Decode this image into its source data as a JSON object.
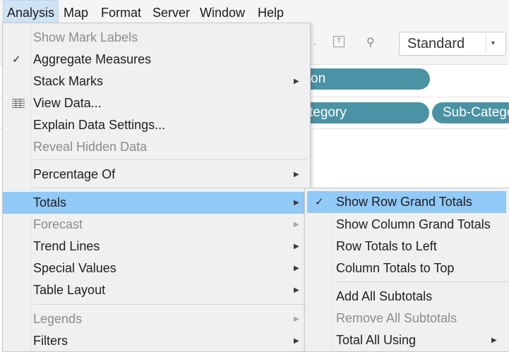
{
  "menubar": {
    "items": [
      {
        "label": "Analysis"
      },
      {
        "label": "Map"
      },
      {
        "label": "Format"
      },
      {
        "label": "Server"
      },
      {
        "label": "Window"
      },
      {
        "label": "Help"
      }
    ]
  },
  "toolbar": {
    "fit_select": {
      "value": "Standard"
    }
  },
  "shelves": {
    "columns_pill": "on",
    "rows_pill_1": "tegory",
    "rows_pill_2": "Sub-Catego"
  },
  "analysis_menu": {
    "items": [
      {
        "label": "Show Mark Labels",
        "enabled": false
      },
      {
        "label": "Aggregate Measures",
        "checked": true
      },
      {
        "label": "Stack Marks",
        "submenu": true
      },
      {
        "label": "View Data...",
        "icon": "grid-icon"
      },
      {
        "label": "Explain Data Settings..."
      },
      {
        "label": "Reveal Hidden Data",
        "enabled": false
      },
      {
        "label": "Percentage Of",
        "submenu": true
      },
      {
        "label": "Totals",
        "submenu": true,
        "highlighted": true
      },
      {
        "label": "Forecast",
        "submenu": true,
        "enabled": false
      },
      {
        "label": "Trend Lines",
        "submenu": true
      },
      {
        "label": "Special Values",
        "submenu": true
      },
      {
        "label": "Table Layout",
        "submenu": true
      },
      {
        "label": "Legends",
        "submenu": true,
        "enabled": false
      },
      {
        "label": "Filters",
        "submenu": true
      }
    ]
  },
  "totals_submenu": {
    "items": [
      {
        "label": "Show Row Grand Totals",
        "checked": true,
        "highlighted": true
      },
      {
        "label": "Show Column Grand Totals"
      },
      {
        "label": "Row Totals to Left"
      },
      {
        "label": "Column Totals to Top"
      },
      {
        "label": "Add All Subtotals"
      },
      {
        "label": "Remove All Subtotals",
        "enabled": false
      },
      {
        "label": "Total All Using",
        "submenu": true
      }
    ]
  },
  "glyphs": {
    "check": "✓",
    "submenu_arrow": "▶",
    "dropdown_arrow": "▾"
  },
  "colors": {
    "highlight": "#91c9f7",
    "pill": "#4a93a4",
    "menu_bg": "#f0f0f0"
  }
}
